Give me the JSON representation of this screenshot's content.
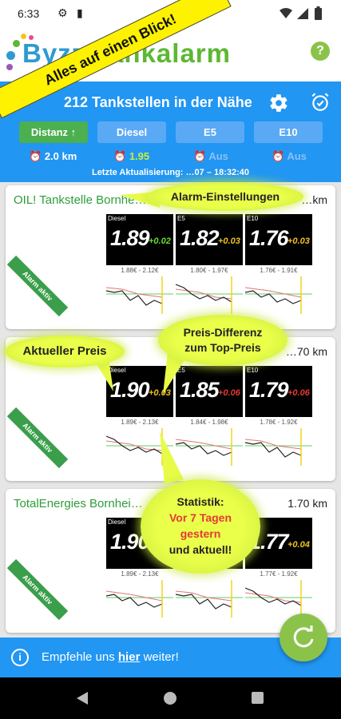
{
  "status_bar": {
    "time": "6:33"
  },
  "app": {
    "logo_part1": "Byzz",
    "logo_part2": "Tankalarm",
    "help_label": "?"
  },
  "promo_banner": "Alles auf einen Blick!",
  "header": {
    "title": "212 Tankstellen in der Nähe",
    "updated_prefix": "Letzte Aktualisierung:",
    "updated_value": "…07 – 18:32:40"
  },
  "tabs": [
    {
      "label": "Distanz ↑",
      "active": true
    },
    {
      "label": "Diesel",
      "active": false
    },
    {
      "label": "E5",
      "active": false
    },
    {
      "label": "E10",
      "active": false
    }
  ],
  "alarm_values": [
    {
      "value": "2.0 km",
      "color": "#ffffff"
    },
    {
      "value": "1.95",
      "color": "#c8f03c"
    },
    {
      "value": "Aus",
      "color": "#8cc1f5"
    },
    {
      "value": "Aus",
      "color": "#8cc1f5"
    }
  ],
  "stations": [
    {
      "name": "OIL! Tankstelle Bornhe…",
      "distance": "…km",
      "ribbon": "Alarm aktiv",
      "fuels": [
        {
          "label": "Diesel",
          "price": "1.89",
          "diff": "+0.02",
          "diff_color": "#6ddc2c",
          "range": "1.88€ - 2.12€"
        },
        {
          "label": "E5",
          "price": "1.82",
          "diff": "+0.03",
          "diff_color": "#f0c020",
          "range": "1.80€ - 1.97€"
        },
        {
          "label": "E10",
          "price": "1.76",
          "diff": "+0.03",
          "diff_color": "#f0c020",
          "range": "1.76€ - 1.91€"
        }
      ]
    },
    {
      "name": "…onn-Br…",
      "distance": "…70 km",
      "ribbon": "Alarm aktiv",
      "fuels": [
        {
          "label": "Diesel",
          "price": "1.90",
          "diff": "+0.03",
          "diff_color": "#f0c020",
          "range": "1.89€ - 2.13€"
        },
        {
          "label": "E5",
          "price": "1.85",
          "diff": "+0.06",
          "diff_color": "#e53935",
          "range": "1.84€ - 1.98€"
        },
        {
          "label": "E10",
          "price": "1.79",
          "diff": "+0.06",
          "diff_color": "#e53935",
          "range": "1.78€ - 1.92€"
        }
      ]
    },
    {
      "name": "TotalEnergies Bornhei…",
      "distance": "1.70 km",
      "ribbon": "Alarm aktiv",
      "fuels": [
        {
          "label": "Diesel",
          "price": "1.90",
          "diff": "",
          "diff_color": "#f0c020",
          "range": "1.89€ - 2.13€"
        },
        {
          "label": "E5",
          "price": "",
          "diff": "",
          "diff_color": "#f0c020",
          "range": ""
        },
        {
          "label": "E10",
          "price": "1.77",
          "diff": "+0.04",
          "diff_color": "#f0c020",
          "range": "1.77€ - 1.92€"
        }
      ]
    }
  ],
  "callouts": {
    "alarm": "Alarm-Einstellungen",
    "current": "Aktueller Preis",
    "diff_line1": "Preis-Differenz",
    "diff_line2": "zum Top-Preis",
    "stat_line1": "Statistik:",
    "stat_line2": "Vor 7 Tagen",
    "stat_line3": "gestern",
    "stat_line4": "und aktuell!"
  },
  "bottom": {
    "prefix": "Empfehle uns ",
    "link": "hier",
    "suffix": " weiter!"
  },
  "colors": {
    "primary": "#2196f3",
    "green": "#4caf50",
    "accent": "#8bc34a"
  }
}
